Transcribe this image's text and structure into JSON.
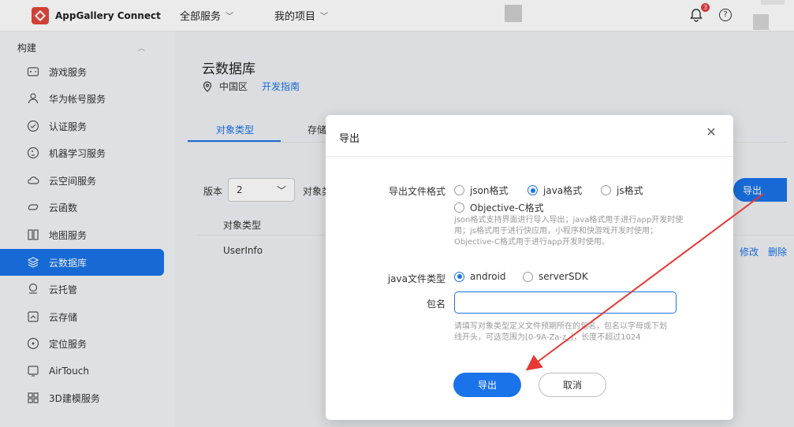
{
  "topbar": {
    "brand": "AppGallery Connect",
    "nav": [
      {
        "label": "全部服务"
      },
      {
        "label": "我的项目"
      }
    ],
    "notification_count": "3",
    "help_glyph": "?"
  },
  "sidebar": {
    "group": "构建",
    "items": [
      {
        "label": "游戏服务",
        "icon": "gamepad-icon"
      },
      {
        "label": "华为帐号服务",
        "icon": "user-icon"
      },
      {
        "label": "认证服务",
        "icon": "shield-check-icon"
      },
      {
        "label": "机器学习服务",
        "icon": "ml-icon"
      },
      {
        "label": "云空间服务",
        "icon": "cloud-icon"
      },
      {
        "label": "云函数",
        "icon": "function-icon"
      },
      {
        "label": "地图服务",
        "icon": "map-icon"
      },
      {
        "label": "云数据库",
        "icon": "database-icon",
        "active": true
      },
      {
        "label": "云托管",
        "icon": "hosting-icon"
      },
      {
        "label": "云存储",
        "icon": "storage-icon"
      },
      {
        "label": "定位服务",
        "icon": "location-icon"
      },
      {
        "label": "AirTouch",
        "icon": "airtouch-icon"
      },
      {
        "label": "3D建模服务",
        "icon": "grid-icon"
      }
    ]
  },
  "main": {
    "title": "云数据库",
    "region": "中国区",
    "dev_guide": "开发指南",
    "tabs": [
      "对象类型",
      "存储"
    ],
    "version_label": "版本",
    "version_value": "2",
    "objtype_label": "对象类",
    "export_button": "导出",
    "table": {
      "header": "对象类型",
      "rows": [
        {
          "name": "UserInfo",
          "edit": "修改",
          "delete": "删除"
        }
      ]
    }
  },
  "modal": {
    "title": "导出",
    "format_label": "导出文件格式",
    "formats": [
      {
        "label": "json格式",
        "selected": false
      },
      {
        "label": "java格式",
        "selected": true
      },
      {
        "label": "js格式",
        "selected": false
      },
      {
        "label": "Objective-C格式",
        "selected": false
      }
    ],
    "format_hint": [
      "json格式支持界面进行导入导出；java格式用于进行app开发时使",
      "用；js格式用于进行快应用，小程序和快游戏开发时使用；",
      "Objective-C格式用于进行app开发时使用。"
    ],
    "java_type_label": "java文件类型",
    "java_types": [
      {
        "label": "android",
        "selected": true
      },
      {
        "label": "serverSDK",
        "selected": false
      }
    ],
    "package_label": "包名",
    "package_value": "",
    "package_hint": [
      "请填写对象类型定义文件预期所在的包名，包名以字母或下划",
      "线开头，可选范围为[0-9A-Za-z_]，长度不超过1024"
    ],
    "confirm": "导出",
    "cancel": "取消"
  },
  "colors": {
    "accent": "#1a73e8",
    "annotation_arrow": "#e53935",
    "logo": "#e1473d"
  }
}
